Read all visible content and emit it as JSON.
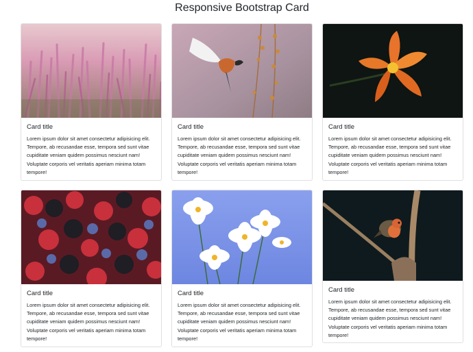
{
  "page": {
    "title": "Responsive Bootstrap Card"
  },
  "cards": [
    {
      "title": "Card title",
      "text": "Lorem ipsum dolor sit amet consectetur adipisicing elit. Tempore, ab recusandae esse, tempora sed sunt vitae cupiditate veniam quidem possimus nesciunt nam! Voluptate corporis vel veritatis aperiam minima totam tempore!",
      "image": "heather-flowers-photo"
    },
    {
      "title": "Card title",
      "text": "Lorem ipsum dolor sit amet consectetur adipisicing elit. Tempore, ab recusandae esse, tempora sed sunt vitae cupiditate veniam quidem possimus nesciunt nam! Voluptate corporis vel veritatis aperiam minima totam tempore!",
      "image": "bird-in-flight-photo"
    },
    {
      "title": "Card title",
      "text": "Lorem ipsum dolor sit amet consectetur adipisicing elit. Tempore, ab recusandae esse, tempora sed sunt vitae cupiditate veniam quidem possimus nesciunt nam! Voluptate corporis vel veritatis aperiam minima totam tempore!",
      "image": "orange-lily-photo"
    },
    {
      "title": "Card title",
      "text": "Lorem ipsum dolor sit amet consectetur adipisicing elit. Tempore, ab recusandae esse, tempora sed sunt vitae cupiditate veniam quidem possimus nesciunt nam! Voluptate corporis vel veritatis aperiam minima totam tempore!",
      "image": "mixed-berries-photo"
    },
    {
      "title": "Card title",
      "text": "Lorem ipsum dolor sit amet consectetur adipisicing elit. Tempore, ab recusandae esse, tempora sed sunt vitae cupiditate veniam quidem possimus nesciunt nam! Voluptate corporis vel veritatis aperiam minima totam tempore!",
      "image": "white-daisies-photo"
    },
    {
      "title": "Card title",
      "text": "Lorem ipsum dolor sit amet consectetur adipisicing elit. Tempore, ab recusandae esse, tempora sed sunt vitae cupiditate veniam quidem possimus nesciunt nam! Voluptate corporis vel veritatis aperiam minima totam tempore!",
      "image": "robin-on-branch-photo"
    }
  ]
}
